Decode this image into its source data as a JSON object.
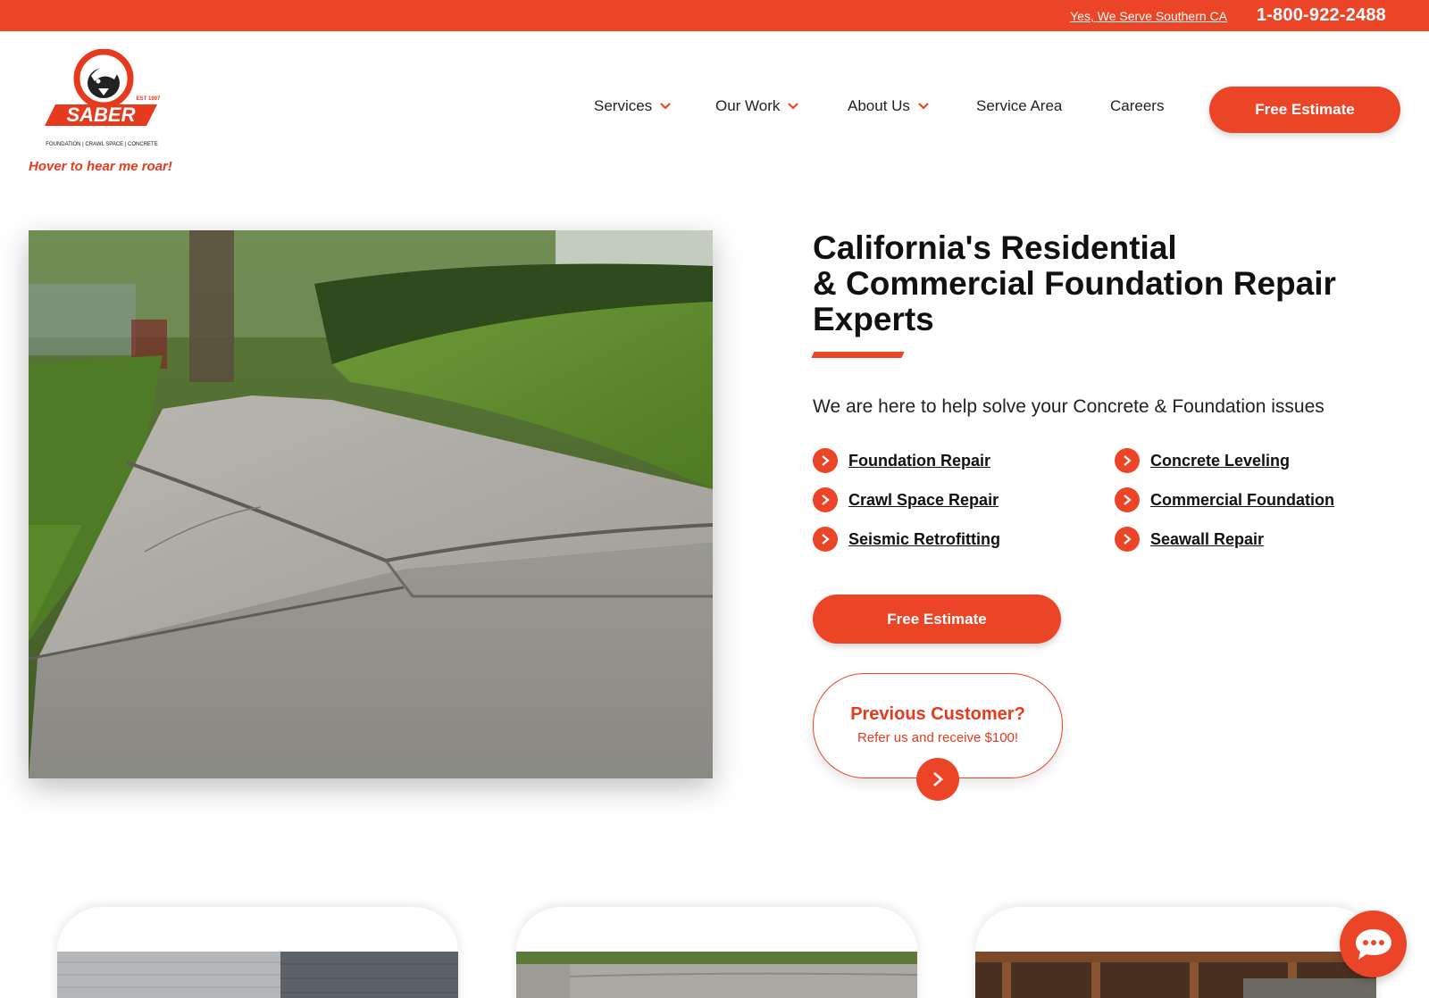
{
  "topbar": {
    "serve_link": "Yes, We Serve Southern CA",
    "phone": "1-800-922-2488"
  },
  "logo": {
    "brand": "SABER",
    "est": "EST 1997",
    "tagline": "FOUNDATION | CRAWL SPACE | CONCRETE",
    "roar": "Hover to hear me roar!"
  },
  "nav": {
    "items": [
      {
        "label": "Services",
        "dropdown": true
      },
      {
        "label": "Our Work",
        "dropdown": true
      },
      {
        "label": "About Us",
        "dropdown": true
      },
      {
        "label": "Service Area",
        "dropdown": false
      },
      {
        "label": "Careers",
        "dropdown": false
      }
    ],
    "cta": "Free Estimate"
  },
  "hero": {
    "headline_line1": "California's Residential",
    "headline_line2": "& Commercial Foundation Repair",
    "headline_line3": "Experts",
    "subhead": "We are here to help solve your Concrete & Foundation issues",
    "services": [
      "Foundation Repair",
      "Concrete Leveling",
      "Crawl Space Repair",
      "Commercial Foundation",
      "Seismic Retrofitting",
      "Seawall Repair"
    ],
    "cta": "Free Estimate",
    "refer_title": "Previous Customer?",
    "refer_text": "Refer us and receive $100!"
  },
  "colors": {
    "accent": "#ec4426",
    "text": "#111111"
  },
  "icons": {
    "chevron": "chevron-down-icon",
    "arrow": "arrow-right-icon",
    "chat": "chat-bubble-icon"
  }
}
